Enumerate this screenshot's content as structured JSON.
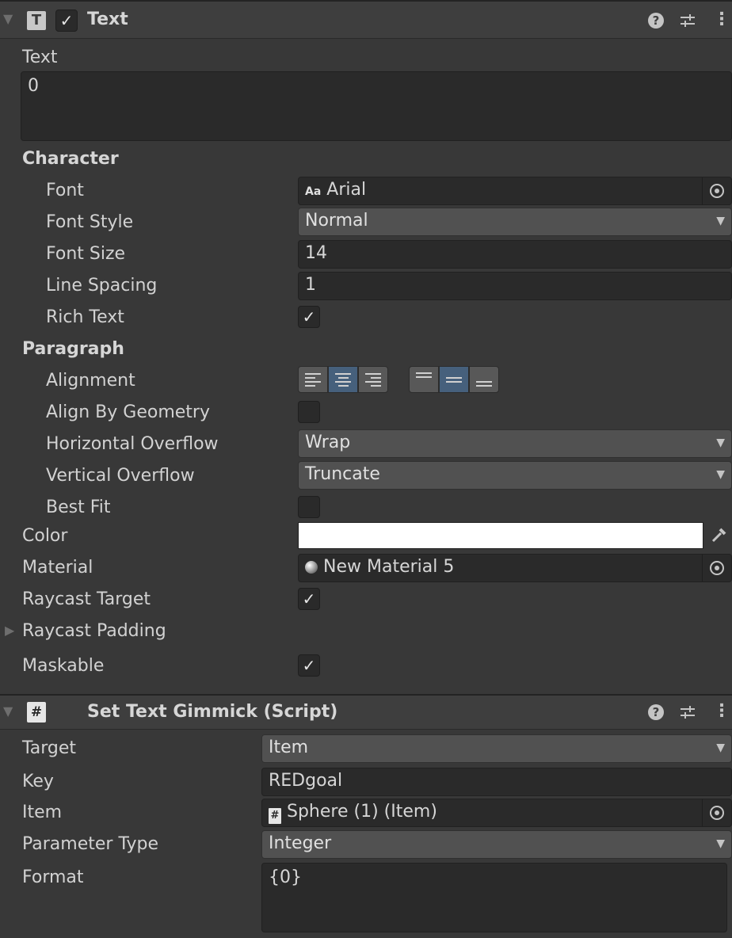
{
  "text_component": {
    "title": "Text",
    "type_icon_letter": "T",
    "enabled": true,
    "help_icon": "help-icon",
    "presets_icon": "sliders-icon",
    "menu_icon": "kebab-menu-icon",
    "text_label": "Text",
    "text_value": "0",
    "character_section": "Character",
    "font_label": "Font",
    "font_icon_text": "Aa",
    "font_value": "Arial",
    "font_style_label": "Font Style",
    "font_style_value": "Normal",
    "font_size_label": "Font Size",
    "font_size_value": "14",
    "line_spacing_label": "Line Spacing",
    "line_spacing_value": "1",
    "rich_text_label": "Rich Text",
    "rich_text_checked": true,
    "paragraph_section": "Paragraph",
    "alignment_label": "Alignment",
    "alignment_horizontal_selected": "center",
    "alignment_vertical_selected": "middle",
    "align_by_geometry_label": "Align By Geometry",
    "align_by_geometry_checked": false,
    "horizontal_overflow_label": "Horizontal Overflow",
    "horizontal_overflow_value": "Wrap",
    "vertical_overflow_label": "Vertical Overflow",
    "vertical_overflow_value": "Truncate",
    "best_fit_label": "Best Fit",
    "best_fit_checked": false,
    "color_label": "Color",
    "color_value": "#ffffff",
    "material_label": "Material",
    "material_value": "New Material 5",
    "raycast_target_label": "Raycast Target",
    "raycast_target_checked": true,
    "raycast_padding_label": "Raycast Padding",
    "maskable_label": "Maskable",
    "maskable_checked": true
  },
  "script_component": {
    "title": "Set Text Gimmick (Script)",
    "type_icon_letter": "#",
    "target_label": "Target",
    "target_value": "Item",
    "key_label": "Key",
    "key_value": "REDgoal",
    "item_label": "Item",
    "item_icon_letter": "#",
    "item_value": "Sphere (1) (Item)",
    "parameter_type_label": "Parameter Type",
    "parameter_type_value": "Integer",
    "format_label": "Format",
    "format_value": "{0}"
  },
  "symbols": {
    "check": "✓",
    "dropdown": "▼",
    "foldout_open": "▼",
    "foldout_closed": "▶",
    "help": "?",
    "kebab": "⋮"
  },
  "colors": {
    "accent_selected": "#46607c",
    "panel_bg": "#383838",
    "field_bg": "#2a2a2a"
  }
}
